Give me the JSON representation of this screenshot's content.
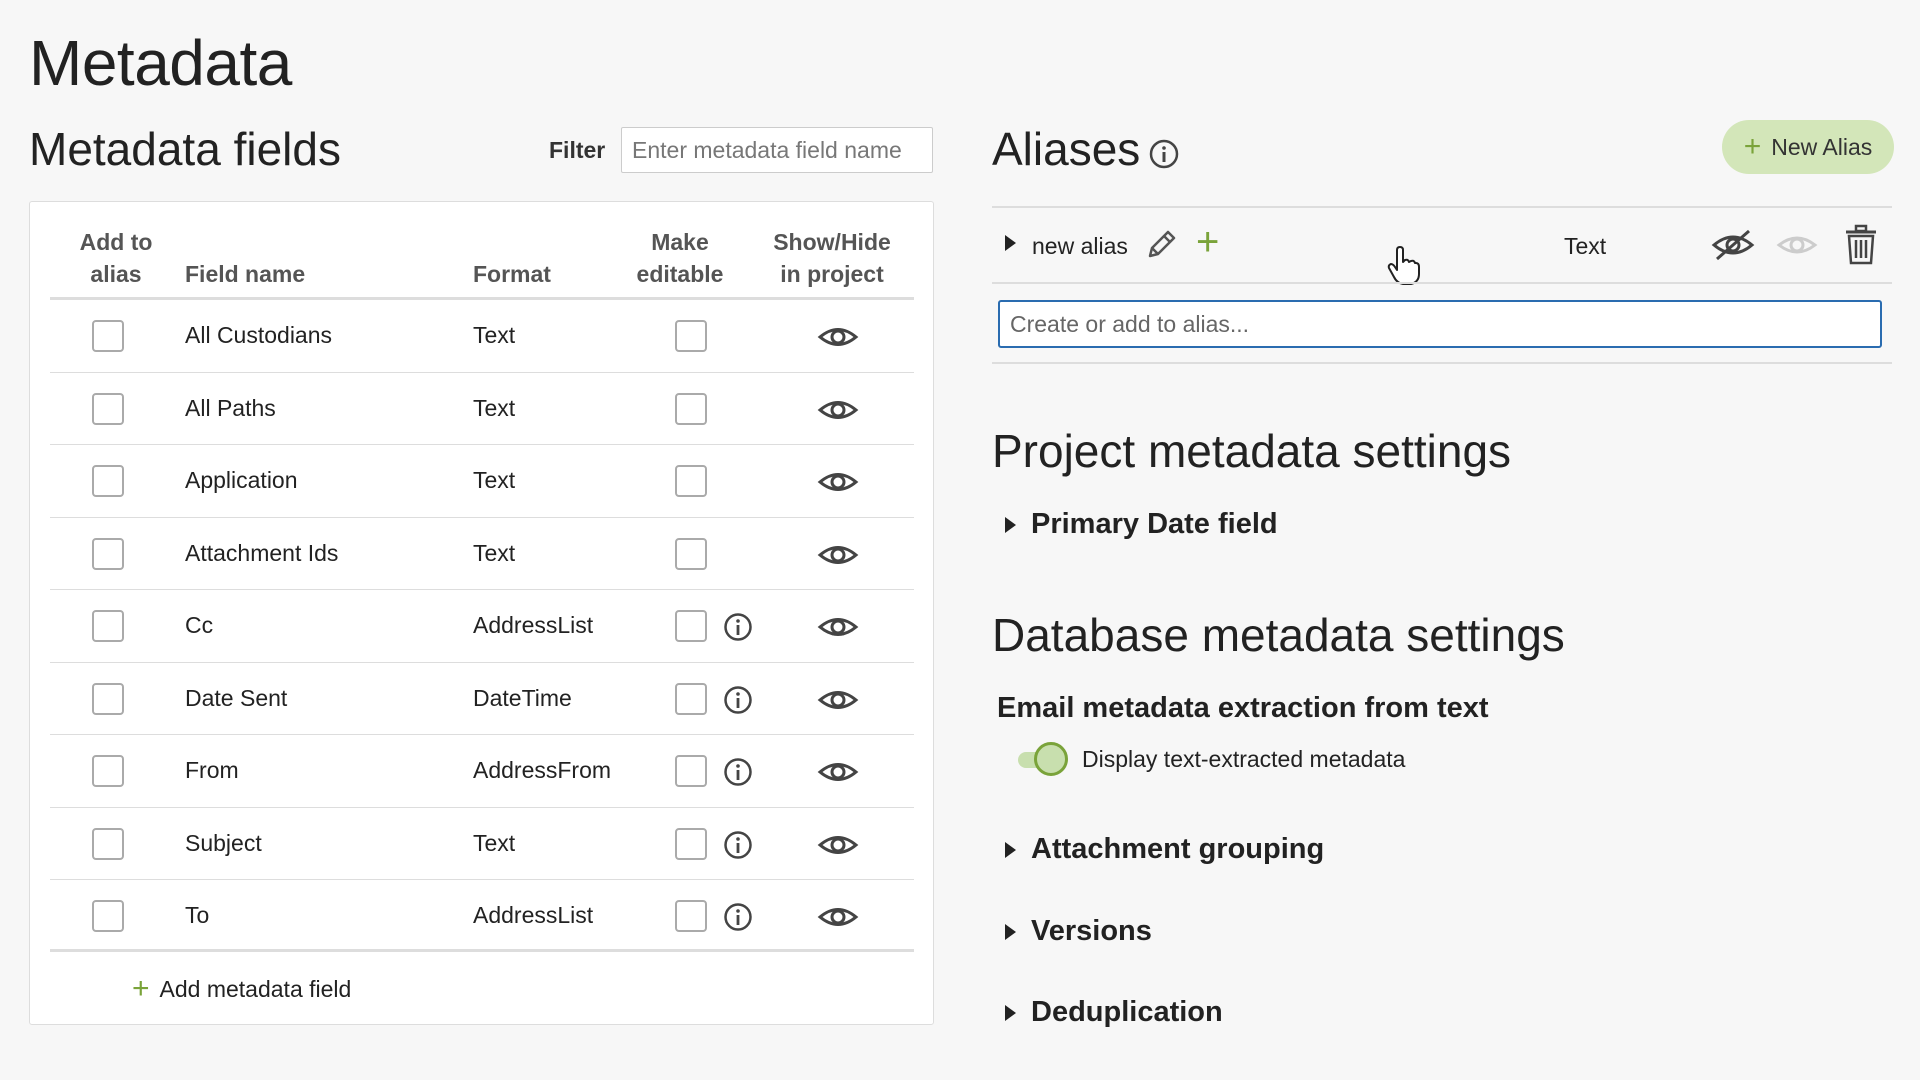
{
  "page": {
    "title": "Metadata"
  },
  "metadata_fields": {
    "title": "Metadata fields",
    "filter_label": "Filter",
    "filter_placeholder": "Enter metadata field name",
    "headers": {
      "add_to_alias": [
        "Add to",
        "alias"
      ],
      "field_name": "Field name",
      "format": "Format",
      "make_editable": [
        "Make",
        "editable"
      ],
      "show_hide": [
        "Show/Hide",
        "in project"
      ]
    },
    "rows": [
      {
        "name": "All Custodians",
        "format": "Text",
        "has_info": false
      },
      {
        "name": "All Paths",
        "format": "Text",
        "has_info": false
      },
      {
        "name": "Application",
        "format": "Text",
        "has_info": false
      },
      {
        "name": "Attachment Ids",
        "format": "Text",
        "has_info": false
      },
      {
        "name": "Cc",
        "format": "AddressList",
        "has_info": true
      },
      {
        "name": "Date Sent",
        "format": "DateTime",
        "has_info": true
      },
      {
        "name": "From",
        "format": "AddressFrom",
        "has_info": true
      },
      {
        "name": "Subject",
        "format": "Text",
        "has_info": true
      },
      {
        "name": "To",
        "format": "AddressList",
        "has_info": true
      }
    ],
    "add_field_label": "Add metadata field"
  },
  "aliases": {
    "title": "Aliases",
    "new_alias_label": "New Alias",
    "alias_row": {
      "name": "new alias",
      "format": "Text"
    },
    "input_placeholder": "Create or add to alias..."
  },
  "project_settings": {
    "title": "Project metadata settings",
    "primary_date": "Primary Date field"
  },
  "database_settings": {
    "title": "Database metadata settings",
    "email_heading": "Email metadata extraction from text",
    "toggle_label": "Display text-extracted metadata",
    "toggle_on": true,
    "sections": [
      "Attachment grouping",
      "Versions",
      "Deduplication"
    ]
  },
  "colors": {
    "accent_green": "#7aa33a",
    "button_green": "#d3e6b9",
    "focus_blue": "#2a6cb0"
  }
}
